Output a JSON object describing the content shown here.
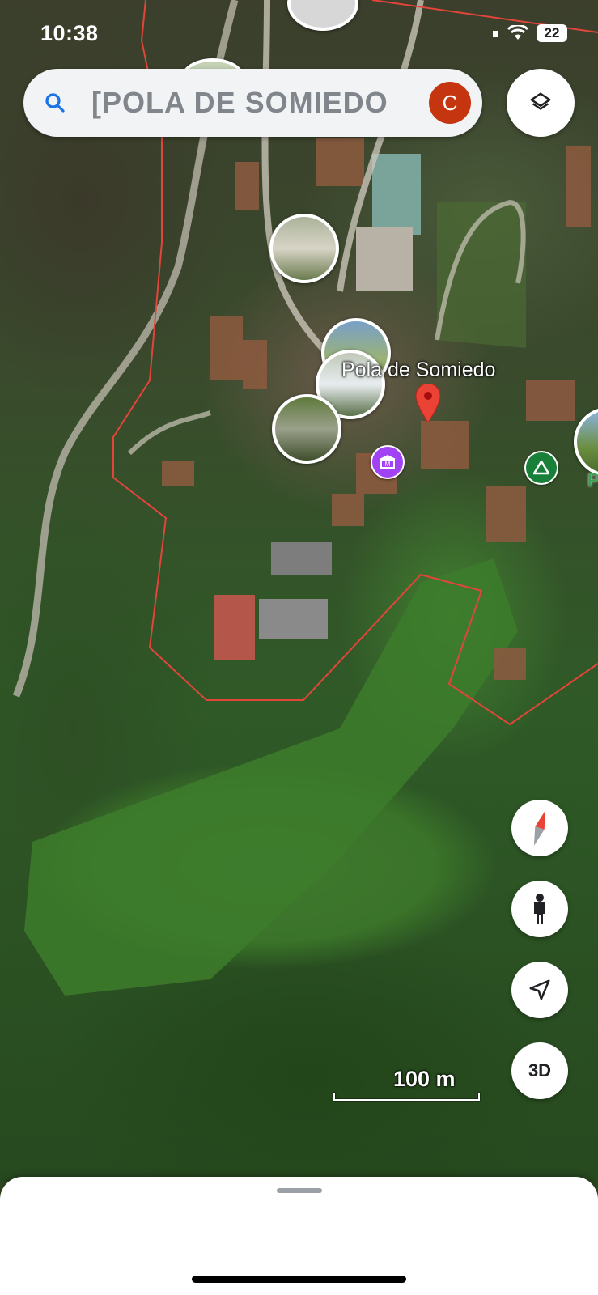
{
  "status_bar": {
    "time": "10:38",
    "battery": "22"
  },
  "search": {
    "query": "[POLA DE SOMIEDO",
    "avatar_letter": "C",
    "avatar_color": "#c5350f"
  },
  "map": {
    "place_label": "Pola de Somiedo",
    "place_label_partial": "Pon",
    "scale_label": "100 m",
    "boundary_color": "#e2453a",
    "pin_color": "#ea4335",
    "museum_icon_color": "#a142f4",
    "park_icon_color": "#188038"
  },
  "controls": {
    "layers_icon": "layers-icon",
    "compass_icon": "compass-icon",
    "street_view_icon": "pegman-icon",
    "location_icon": "location-arrow-icon",
    "btn_3d_label": "3D"
  }
}
